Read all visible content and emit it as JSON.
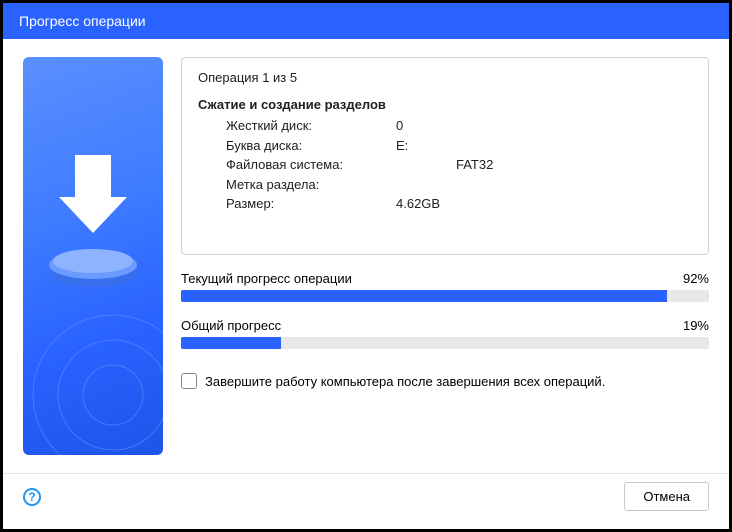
{
  "window_title": "Прогресс операции",
  "operation_count": "Операция 1 из 5",
  "operation_title": "Сжатие и создание разделов",
  "details": {
    "hard_disk_label": "Жесткий диск:",
    "hard_disk_value": "0",
    "drive_letter_label": "Буква диска:",
    "drive_letter_value": "E:",
    "filesystem_label": "Файловая система:",
    "filesystem_value": "FAT32",
    "partition_label_label": "Метка раздела:",
    "partition_label_value": "",
    "size_label": "Размер:",
    "size_value": "4.62GB"
  },
  "current_progress": {
    "label": "Текущий прогресс операции",
    "percent_text": "92%",
    "percent": 92
  },
  "overall_progress": {
    "label": "Общий прогресс",
    "percent_text": "19%",
    "percent": 19
  },
  "checkbox_label": "Завершите работу компьютера после завершения всех операций.",
  "cancel_label": "Отмена",
  "help_glyph": "?"
}
